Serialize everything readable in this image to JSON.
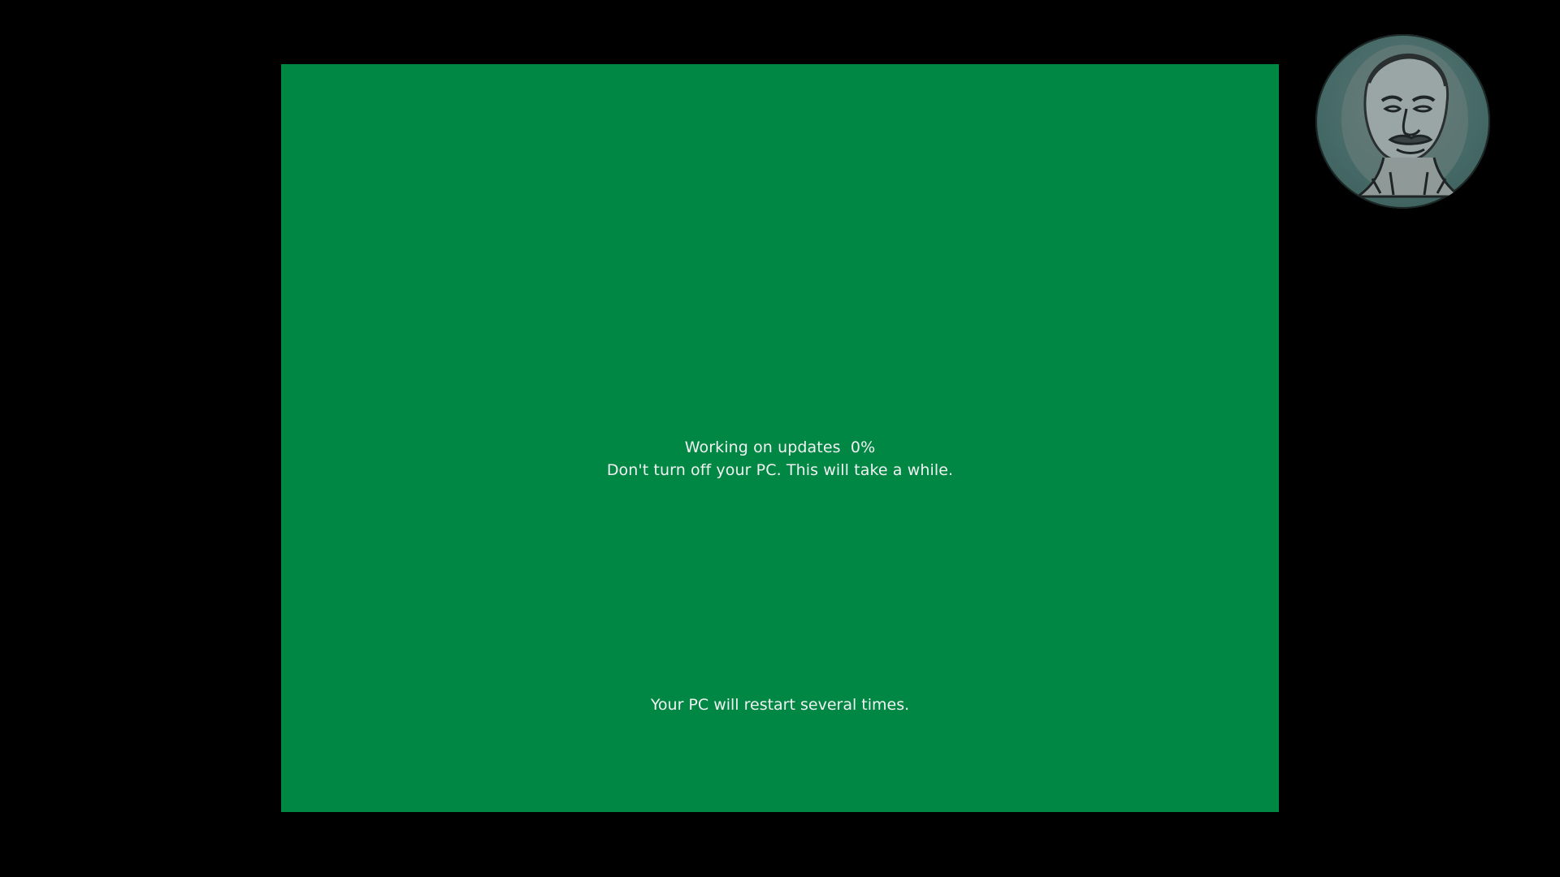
{
  "update_screen": {
    "background_color": "#008744",
    "status_prefix": "Working on updates",
    "progress_percent": "0%",
    "warning": "Don't turn off your PC. This will take a while.",
    "restart_note": "Your PC will restart several times."
  },
  "webcam_overlay": {
    "icon": "presenter-avatar"
  }
}
